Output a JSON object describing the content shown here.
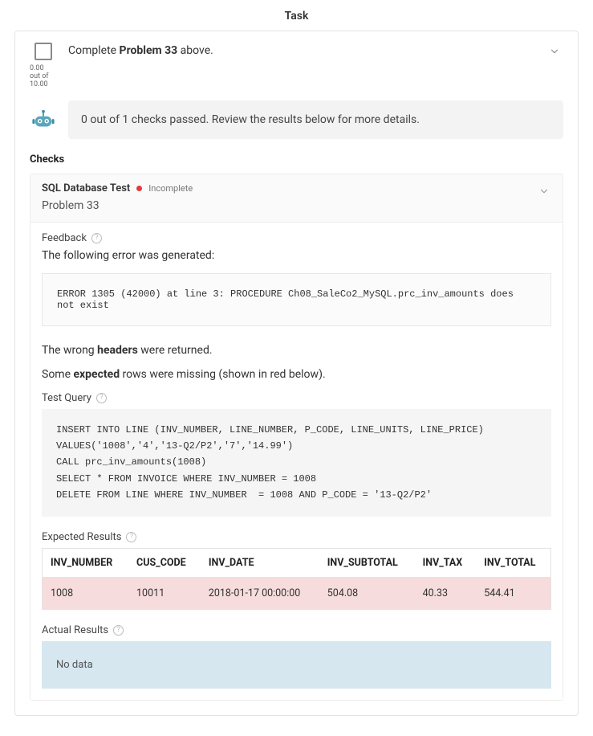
{
  "page": {
    "title": "Task"
  },
  "task": {
    "title_prefix": "Complete ",
    "title_bold": "Problem 33",
    "title_suffix": " above.",
    "score_earned": "0.00",
    "score_label_mid": "out of",
    "score_max": "10.00"
  },
  "status": {
    "banner": "0 out of 1 checks passed. Review the results below for more details."
  },
  "checks": {
    "heading": "Checks",
    "items": [
      {
        "name": "SQL Database Test",
        "status_label": "Incomplete",
        "status_color": "#e23b3b",
        "problem_label": "Problem 33",
        "feedback": {
          "heading": "Feedback",
          "intro": "The following error was generated:",
          "error": "ERROR 1305 (42000) at line 3: PROCEDURE Ch08_SaleCo2_MySQL.prc_inv_amounts does not exist",
          "wrong_headers_pre": "The wrong ",
          "wrong_headers_bold": "headers",
          "wrong_headers_post": " were returned.",
          "missing_pre": "Some ",
          "missing_bold": "expected",
          "missing_post": " rows were missing (shown in red below)."
        },
        "test_query": {
          "heading": "Test Query",
          "code": "INSERT INTO LINE (INV_NUMBER, LINE_NUMBER, P_CODE, LINE_UNITS, LINE_PRICE)\nVALUES('1008','4','13-Q2/P2','7','14.99')\nCALL prc_inv_amounts(1008)\nSELECT * FROM INVOICE WHERE INV_NUMBER = 1008\nDELETE FROM LINE WHERE INV_NUMBER  = 1008 AND P_CODE = '13-Q2/P2'"
        },
        "expected": {
          "heading": "Expected Results",
          "columns": [
            "INV_NUMBER",
            "CUS_CODE",
            "INV_DATE",
            "INV_SUBTOTAL",
            "INV_TAX",
            "INV_TOTAL"
          ],
          "rows": [
            {
              "missing": true,
              "cells": [
                "1008",
                "10011",
                "2018-01-17 00:00:00",
                "504.08",
                "40.33",
                "544.41"
              ]
            }
          ]
        },
        "actual": {
          "heading": "Actual Results",
          "no_data": "No data"
        }
      }
    ]
  }
}
